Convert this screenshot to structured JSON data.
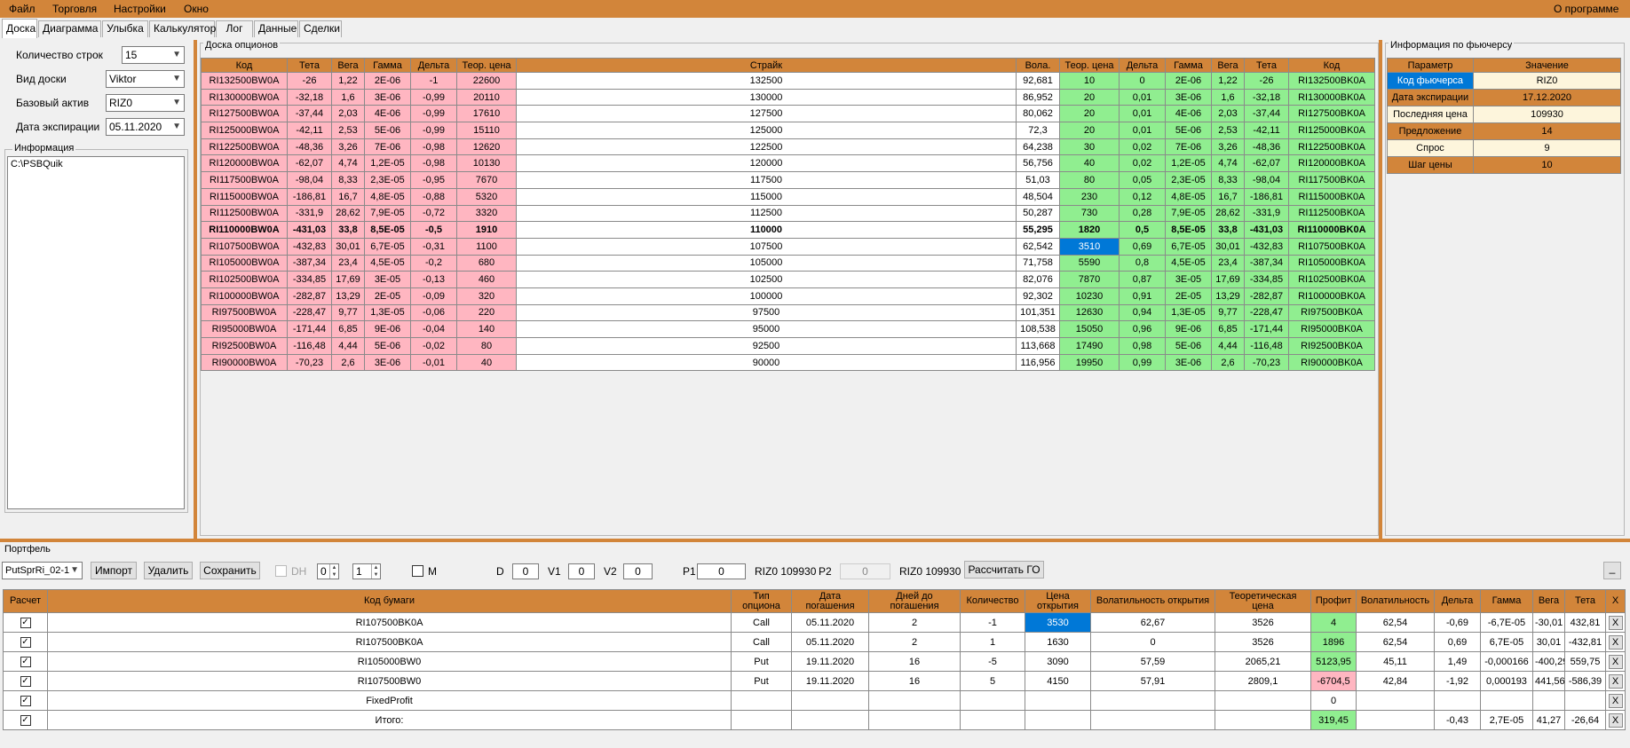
{
  "menu": {
    "file": "Файл",
    "trade": "Торговля",
    "settings": "Настройки",
    "window": "Окно",
    "about": "О программе"
  },
  "tabs": [
    "Доска",
    "Диаграмма",
    "Улыбка",
    "Калькулятор",
    "Лог",
    "Данные",
    "Сделки"
  ],
  "left": {
    "rows_label": "Количество строк",
    "rows_value": "15",
    "view_label": "Вид доски",
    "view_value": "Viktor",
    "asset_label": "Базовый актив",
    "asset_value": "RIZ0",
    "exp_label": "Дата экспирации",
    "exp_value": "05.11.2020",
    "info_label": "Информация",
    "info_text": "C:\\PSBQuik"
  },
  "board": {
    "title": "Доска опционов",
    "headers": [
      "Код",
      "Тета",
      "Вега",
      "Гамма",
      "Дельта",
      "Теор. цена",
      "Страйк",
      "Вола.",
      "Теор. цена",
      "Дельта",
      "Гамма",
      "Вега",
      "Тета",
      "Код"
    ],
    "rows": [
      [
        "RI132500BW0A",
        "-26",
        "1,22",
        "2E-06",
        "-1",
        "22600",
        "132500",
        "92,681",
        "10",
        "0",
        "2E-06",
        "1,22",
        "-26",
        "RI132500BK0A"
      ],
      [
        "RI130000BW0A",
        "-32,18",
        "1,6",
        "3E-06",
        "-0,99",
        "20110",
        "130000",
        "86,952",
        "20",
        "0,01",
        "3E-06",
        "1,6",
        "-32,18",
        "RI130000BK0A"
      ],
      [
        "RI127500BW0A",
        "-37,44",
        "2,03",
        "4E-06",
        "-0,99",
        "17610",
        "127500",
        "80,062",
        "20",
        "0,01",
        "4E-06",
        "2,03",
        "-37,44",
        "RI127500BK0A"
      ],
      [
        "RI125000BW0A",
        "-42,11",
        "2,53",
        "5E-06",
        "-0,99",
        "15110",
        "125000",
        "72,3",
        "20",
        "0,01",
        "5E-06",
        "2,53",
        "-42,11",
        "RI125000BK0A"
      ],
      [
        "RI122500BW0A",
        "-48,36",
        "3,26",
        "7E-06",
        "-0,98",
        "12620",
        "122500",
        "64,238",
        "30",
        "0,02",
        "7E-06",
        "3,26",
        "-48,36",
        "RI122500BK0A"
      ],
      [
        "RI120000BW0A",
        "-62,07",
        "4,74",
        "1,2E-05",
        "-0,98",
        "10130",
        "120000",
        "56,756",
        "40",
        "0,02",
        "1,2E-05",
        "4,74",
        "-62,07",
        "RI120000BK0A"
      ],
      [
        "RI117500BW0A",
        "-98,04",
        "8,33",
        "2,3E-05",
        "-0,95",
        "7670",
        "117500",
        "51,03",
        "80",
        "0,05",
        "2,3E-05",
        "8,33",
        "-98,04",
        "RI117500BK0A"
      ],
      [
        "RI115000BW0A",
        "-186,81",
        "16,7",
        "4,8E-05",
        "-0,88",
        "5320",
        "115000",
        "48,504",
        "230",
        "0,12",
        "4,8E-05",
        "16,7",
        "-186,81",
        "RI115000BK0A"
      ],
      [
        "RI112500BW0A",
        "-331,9",
        "28,62",
        "7,9E-05",
        "-0,72",
        "3320",
        "112500",
        "50,287",
        "730",
        "0,28",
        "7,9E-05",
        "28,62",
        "-331,9",
        "RI112500BK0A"
      ],
      [
        "RI110000BW0A",
        "-431,03",
        "33,8",
        "8,5E-05",
        "-0,5",
        "1910",
        "110000",
        "55,295",
        "1820",
        "0,5",
        "8,5E-05",
        "33,8",
        "-431,03",
        "RI110000BK0A"
      ],
      [
        "RI107500BW0A",
        "-432,83",
        "30,01",
        "6,7E-05",
        "-0,31",
        "1100",
        "107500",
        "62,542",
        "3510",
        "0,69",
        "6,7E-05",
        "30,01",
        "-432,83",
        "RI107500BK0A"
      ],
      [
        "RI105000BW0A",
        "-387,34",
        "23,4",
        "4,5E-05",
        "-0,2",
        "680",
        "105000",
        "71,758",
        "5590",
        "0,8",
        "4,5E-05",
        "23,4",
        "-387,34",
        "RI105000BK0A"
      ],
      [
        "RI102500BW0A",
        "-334,85",
        "17,69",
        "3E-05",
        "-0,13",
        "460",
        "102500",
        "82,076",
        "7870",
        "0,87",
        "3E-05",
        "17,69",
        "-334,85",
        "RI102500BK0A"
      ],
      [
        "RI100000BW0A",
        "-282,87",
        "13,29",
        "2E-05",
        "-0,09",
        "320",
        "100000",
        "92,302",
        "10230",
        "0,91",
        "2E-05",
        "13,29",
        "-282,87",
        "RI100000BK0A"
      ],
      [
        "RI97500BW0A",
        "-228,47",
        "9,77",
        "1,3E-05",
        "-0,06",
        "220",
        "97500",
        "101,351",
        "12630",
        "0,94",
        "1,3E-05",
        "9,77",
        "-228,47",
        "RI97500BK0A"
      ],
      [
        "RI95000BW0A",
        "-171,44",
        "6,85",
        "9E-06",
        "-0,04",
        "140",
        "95000",
        "108,538",
        "15050",
        "0,96",
        "9E-06",
        "6,85",
        "-171,44",
        "RI95000BK0A"
      ],
      [
        "RI92500BW0A",
        "-116,48",
        "4,44",
        "5E-06",
        "-0,02",
        "80",
        "92500",
        "113,668",
        "17490",
        "0,98",
        "5E-06",
        "4,44",
        "-116,48",
        "RI92500BK0A"
      ],
      [
        "RI90000BW0A",
        "-70,23",
        "2,6",
        "3E-06",
        "-0,01",
        "40",
        "90000",
        "116,956",
        "19950",
        "0,99",
        "3E-06",
        "2,6",
        "-70,23",
        "RI90000BK0A"
      ]
    ]
  },
  "futures": {
    "title": "Информация по фьючерсу",
    "headers": [
      "Параметр",
      "Значение"
    ],
    "rows": [
      [
        "Код фьючерса",
        "RIZ0"
      ],
      [
        "Дата экспирации",
        "17.12.2020"
      ],
      [
        "Последняя цена",
        "109930"
      ],
      [
        "Предложение",
        "14"
      ],
      [
        "Спрос",
        "9"
      ],
      [
        "Шаг цены",
        "10"
      ]
    ]
  },
  "portfolio": {
    "title": "Портфель",
    "name": "PutSprRi_02-1",
    "import": "Импорт",
    "delete": "Удалить",
    "save": "Сохранить",
    "dh": "DH",
    "spin1": "0",
    "spin2": "1",
    "m": "M",
    "d": "D",
    "d_val": "0",
    "v1": "V1",
    "v1_val": "0",
    "v2": "V2",
    "v2_val": "0",
    "p1": "P1",
    "p1_val": "0",
    "riz1": "RIZ0 109930",
    "p2": "P2",
    "p2_val": "0",
    "riz2": "RIZ0 109930",
    "calc": "Рассчитать ГО",
    "minimize": "_",
    "headers": [
      "Расчет",
      "Код бумаги",
      "Тип опциона",
      "Дата погашения",
      "Дней до погашения",
      "Количество",
      "Цена открытия",
      "Волатильность открытия",
      "Теоретическая цена",
      "Профит",
      "Волатильность",
      "Дельта",
      "Гамма",
      "Вега",
      "Тета",
      "X"
    ],
    "rows": [
      [
        "RI107500BK0A",
        "Call",
        "05.11.2020",
        "2",
        "-1",
        "3530",
        "62,67",
        "3526",
        "4",
        "62,54",
        "-0,69",
        "-6,7E-05",
        "-30,01",
        "432,81"
      ],
      [
        "RI107500BK0A",
        "Call",
        "05.11.2020",
        "2",
        "1",
        "1630",
        "0",
        "3526",
        "1896",
        "62,54",
        "0,69",
        "6,7E-05",
        "30,01",
        "-432,81"
      ],
      [
        "RI105000BW0",
        "Put",
        "19.11.2020",
        "16",
        "-5",
        "3090",
        "57,59",
        "2065,21",
        "5123,95",
        "45,11",
        "1,49",
        "-0,000166",
        "-400,29",
        "559,75"
      ],
      [
        "RI107500BW0",
        "Put",
        "19.11.2020",
        "16",
        "5",
        "4150",
        "57,91",
        "2809,1",
        "-6704,5",
        "42,84",
        "-1,92",
        "0,000193",
        "441,56",
        "-586,39"
      ],
      [
        "FixedProfit",
        "",
        "",
        "",
        "",
        "",
        "",
        "",
        "0",
        "",
        "",
        "",
        "",
        ""
      ],
      [
        "Итого:",
        "",
        "",
        "",
        "",
        "",
        "",
        "",
        "319,45",
        "",
        "-0,43",
        "2,7E-05",
        "41,27",
        "-26,64"
      ]
    ],
    "check": "✓",
    "x": "X"
  }
}
